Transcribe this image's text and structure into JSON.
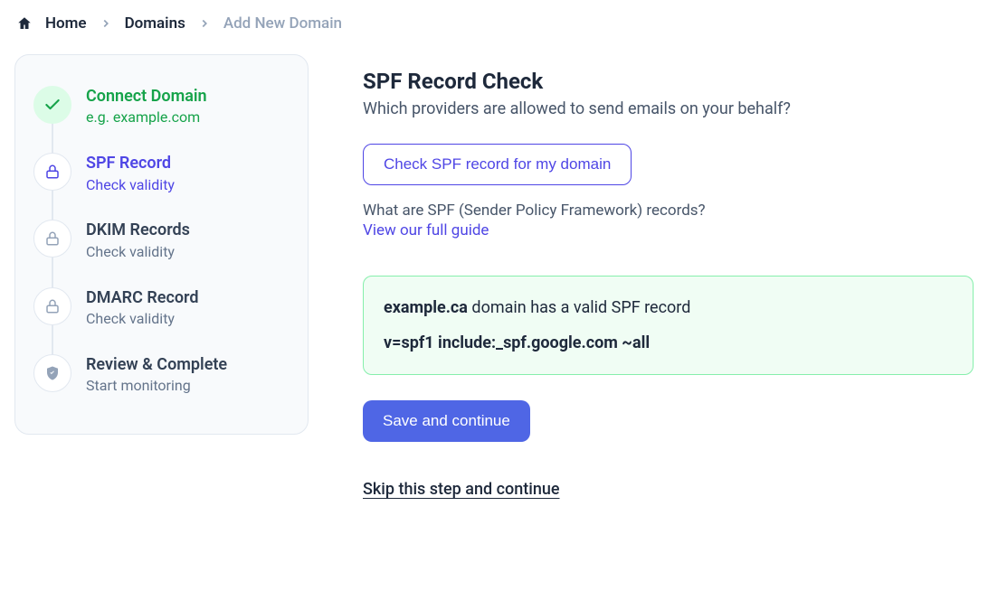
{
  "breadcrumb": {
    "home": "Home",
    "domains": "Domains",
    "current": "Add New Domain"
  },
  "sidebar": {
    "steps": [
      {
        "title": "Connect Domain",
        "sub": "e.g. example.com",
        "state": "done",
        "icon": "check"
      },
      {
        "title": "SPF Record",
        "sub": "Check validity",
        "state": "active",
        "icon": "lock"
      },
      {
        "title": "DKIM Records",
        "sub": "Check validity",
        "state": "pending",
        "icon": "lock"
      },
      {
        "title": "DMARC Record",
        "sub": "Check validity",
        "state": "pending",
        "icon": "lock"
      },
      {
        "title": "Review & Complete",
        "sub": "Start monitoring",
        "state": "pending",
        "icon": "shield"
      }
    ]
  },
  "main": {
    "title": "SPF Record Check",
    "subtitle": "Which providers are allowed to send emails on your behalf?",
    "check_btn": "Check SPF record for my domain",
    "help_text": "What are SPF (Sender Policy Framework) records?",
    "help_link": "View our full guide",
    "result": {
      "domain": "example.ca",
      "msg": " domain has a valid SPF record",
      "spf": "v=spf1 include:_spf.google.com ~all"
    },
    "save_btn": "Save and continue",
    "skip_link": "Skip this step and continue"
  }
}
